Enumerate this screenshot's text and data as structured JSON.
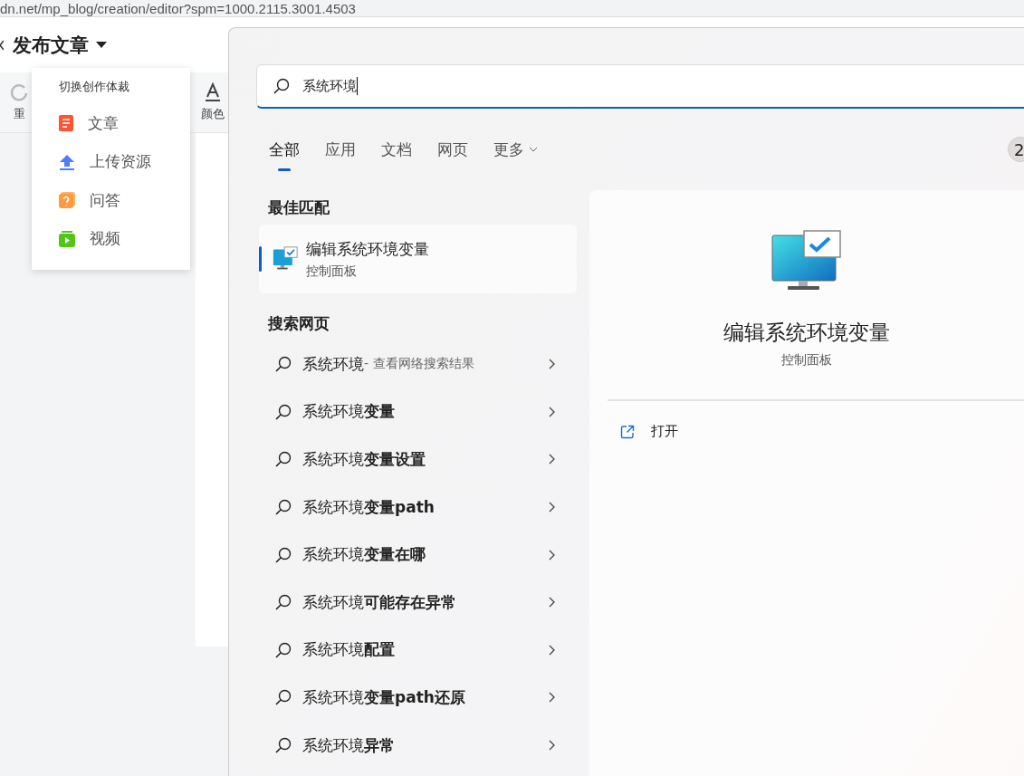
{
  "address_bar": {
    "url": "dn.net/mp_blog/creation/editor?spm=1000.2115.3001.4503"
  },
  "editor": {
    "title": "发布文章",
    "toolbar": [
      {
        "kind": "redo",
        "label": "重"
      },
      {
        "kind": "color",
        "label": "颜色"
      }
    ]
  },
  "type_menu": {
    "heading": "切换创作体裁",
    "items": [
      {
        "kind": "article",
        "label": "文章"
      },
      {
        "kind": "upload",
        "label": "上传资源"
      },
      {
        "kind": "qa",
        "label": "问答"
      },
      {
        "kind": "video",
        "label": "视频"
      }
    ]
  },
  "search": {
    "value": "系统环境",
    "tabs": [
      {
        "label": "全部",
        "selected": true
      },
      {
        "label": "应用",
        "selected": false
      },
      {
        "label": "文档",
        "selected": false
      },
      {
        "label": "网页",
        "selected": false
      },
      {
        "label": "更多",
        "selected": false,
        "dropdown": true
      }
    ],
    "badge": "2",
    "best_match": {
      "heading": "最佳匹配",
      "title": "编辑系统环境变量",
      "subtitle": "控制面板",
      "selected": true
    },
    "web": {
      "heading": "搜索网页",
      "results": [
        {
          "text": "系统环境",
          "suffix": " - 查看网络搜索结果"
        },
        {
          "text": "系统环境**变量**"
        },
        {
          "text": "系统环境**变量设置**"
        },
        {
          "text": "系统环境**变量path**"
        },
        {
          "text": "系统环境**变量在哪**"
        },
        {
          "text": "系统环境**可能存在异常**"
        },
        {
          "text": "系统环境**配置**"
        },
        {
          "text": "系统环境**变量path还原**"
        },
        {
          "text": "系统环境**异常**"
        }
      ]
    },
    "preview": {
      "title": "编辑系统环境变量",
      "subtitle": "控制面板",
      "actions": [
        {
          "kind": "open",
          "label": "打开"
        }
      ]
    }
  }
}
